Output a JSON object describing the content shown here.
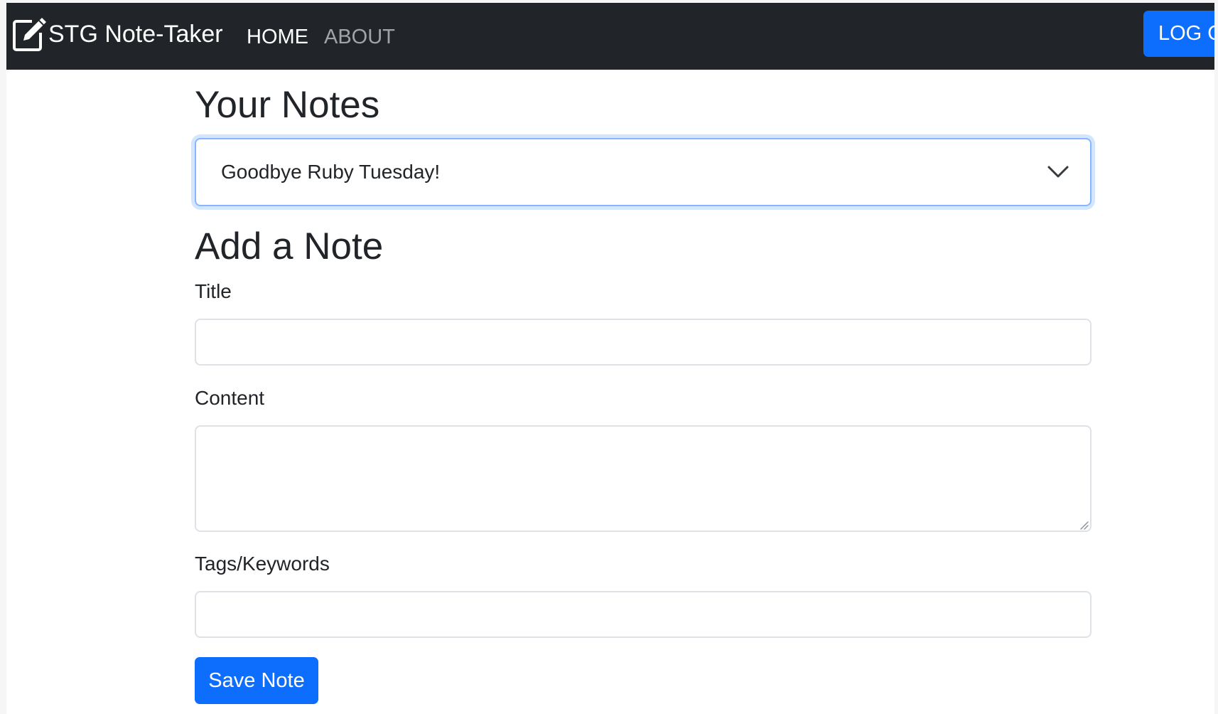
{
  "navbar": {
    "brand_icon": "pencil-square-icon",
    "brand": "STG Note-Taker",
    "home": "HOME",
    "about": "ABOUT",
    "logout": "LOG OUT"
  },
  "notes": {
    "heading": "Your Notes",
    "selected": "Goodbye Ruby Tuesday!",
    "dropdown_icon": "chevron-down-icon"
  },
  "form": {
    "heading": "Add a Note",
    "title_label": "Title",
    "title_value": "",
    "content_label": "Content",
    "content_value": "",
    "tags_label": "Tags/Keywords",
    "tags_value": "",
    "save_label": "Save Note"
  },
  "colors": {
    "navbar_bg": "#212529",
    "primary": "#0d6efd",
    "focus_border": "#86b7fe",
    "field_border": "#dee2e6"
  }
}
